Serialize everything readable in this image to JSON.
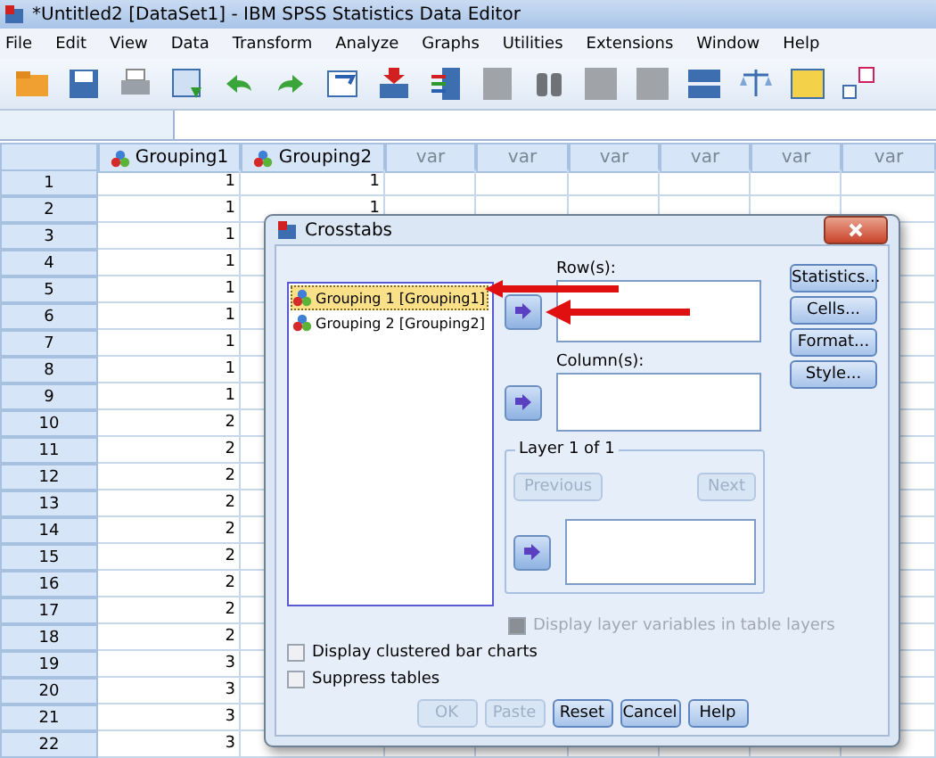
{
  "window": {
    "title": "*Untitled2 [DataSet1] - IBM SPSS Statistics Data Editor"
  },
  "menu": [
    "File",
    "Edit",
    "View",
    "Data",
    "Transform",
    "Analyze",
    "Graphs",
    "Utilities",
    "Extensions",
    "Window",
    "Help"
  ],
  "columns": [
    {
      "label": "Grouping1",
      "kind": "variable"
    },
    {
      "label": "Grouping2",
      "kind": "variable"
    },
    {
      "label": "var",
      "kind": "empty"
    },
    {
      "label": "var",
      "kind": "empty"
    },
    {
      "label": "var",
      "kind": "empty"
    },
    {
      "label": "var",
      "kind": "empty"
    },
    {
      "label": "var",
      "kind": "empty"
    },
    {
      "label": "var",
      "kind": "empty"
    }
  ],
  "rows": [
    {
      "number": "1",
      "cells": [
        "1",
        "1"
      ]
    },
    {
      "number": "2",
      "cells": [
        "1",
        "1"
      ]
    },
    {
      "number": "3",
      "cells": [
        "1"
      ]
    },
    {
      "number": "4",
      "cells": [
        "1"
      ]
    },
    {
      "number": "5",
      "cells": [
        "1"
      ]
    },
    {
      "number": "6",
      "cells": [
        "1"
      ]
    },
    {
      "number": "7",
      "cells": [
        "1"
      ]
    },
    {
      "number": "8",
      "cells": [
        "1"
      ]
    },
    {
      "number": "9",
      "cells": [
        "1"
      ]
    },
    {
      "number": "10",
      "cells": [
        "2"
      ]
    },
    {
      "number": "11",
      "cells": [
        "2"
      ]
    },
    {
      "number": "12",
      "cells": [
        "2"
      ]
    },
    {
      "number": "13",
      "cells": [
        "2"
      ]
    },
    {
      "number": "14",
      "cells": [
        "2"
      ]
    },
    {
      "number": "15",
      "cells": [
        "2"
      ]
    },
    {
      "number": "16",
      "cells": [
        "2"
      ]
    },
    {
      "number": "17",
      "cells": [
        "2"
      ]
    },
    {
      "number": "18",
      "cells": [
        "2"
      ]
    },
    {
      "number": "19",
      "cells": [
        "3"
      ]
    },
    {
      "number": "20",
      "cells": [
        "3"
      ]
    },
    {
      "number": "21",
      "cells": [
        "3"
      ]
    },
    {
      "number": "22",
      "cells": [
        "3"
      ]
    }
  ],
  "dialog": {
    "title": "Crosstabs",
    "variables": [
      {
        "label": "Grouping 1 [Grouping1]",
        "selected": true
      },
      {
        "label": "Grouping 2 [Grouping2]",
        "selected": false
      }
    ],
    "rows_label": "Row(s):",
    "columns_label": "Column(s):",
    "layer": {
      "title": "Layer 1 of 1",
      "buttons": [
        {
          "label": "Previous",
          "disabled": true
        },
        {
          "label": "Next",
          "disabled": true
        }
      ]
    },
    "layer_option": {
      "label": "Display layer variables in table layers",
      "checked": false,
      "disabled": true
    },
    "options": [
      {
        "label": "Display clustered bar charts",
        "checked": false
      },
      {
        "label": "Suppress tables",
        "checked": false
      }
    ],
    "side_buttons": [
      "Statistics...",
      "Cells...",
      "Format...",
      "Style..."
    ],
    "buttons": [
      {
        "label": "OK",
        "disabled": true
      },
      {
        "label": "Paste",
        "disabled": true
      },
      {
        "label": "Reset",
        "disabled": false
      },
      {
        "label": "Cancel",
        "disabled": false
      },
      {
        "label": "Help",
        "disabled": false
      }
    ]
  }
}
